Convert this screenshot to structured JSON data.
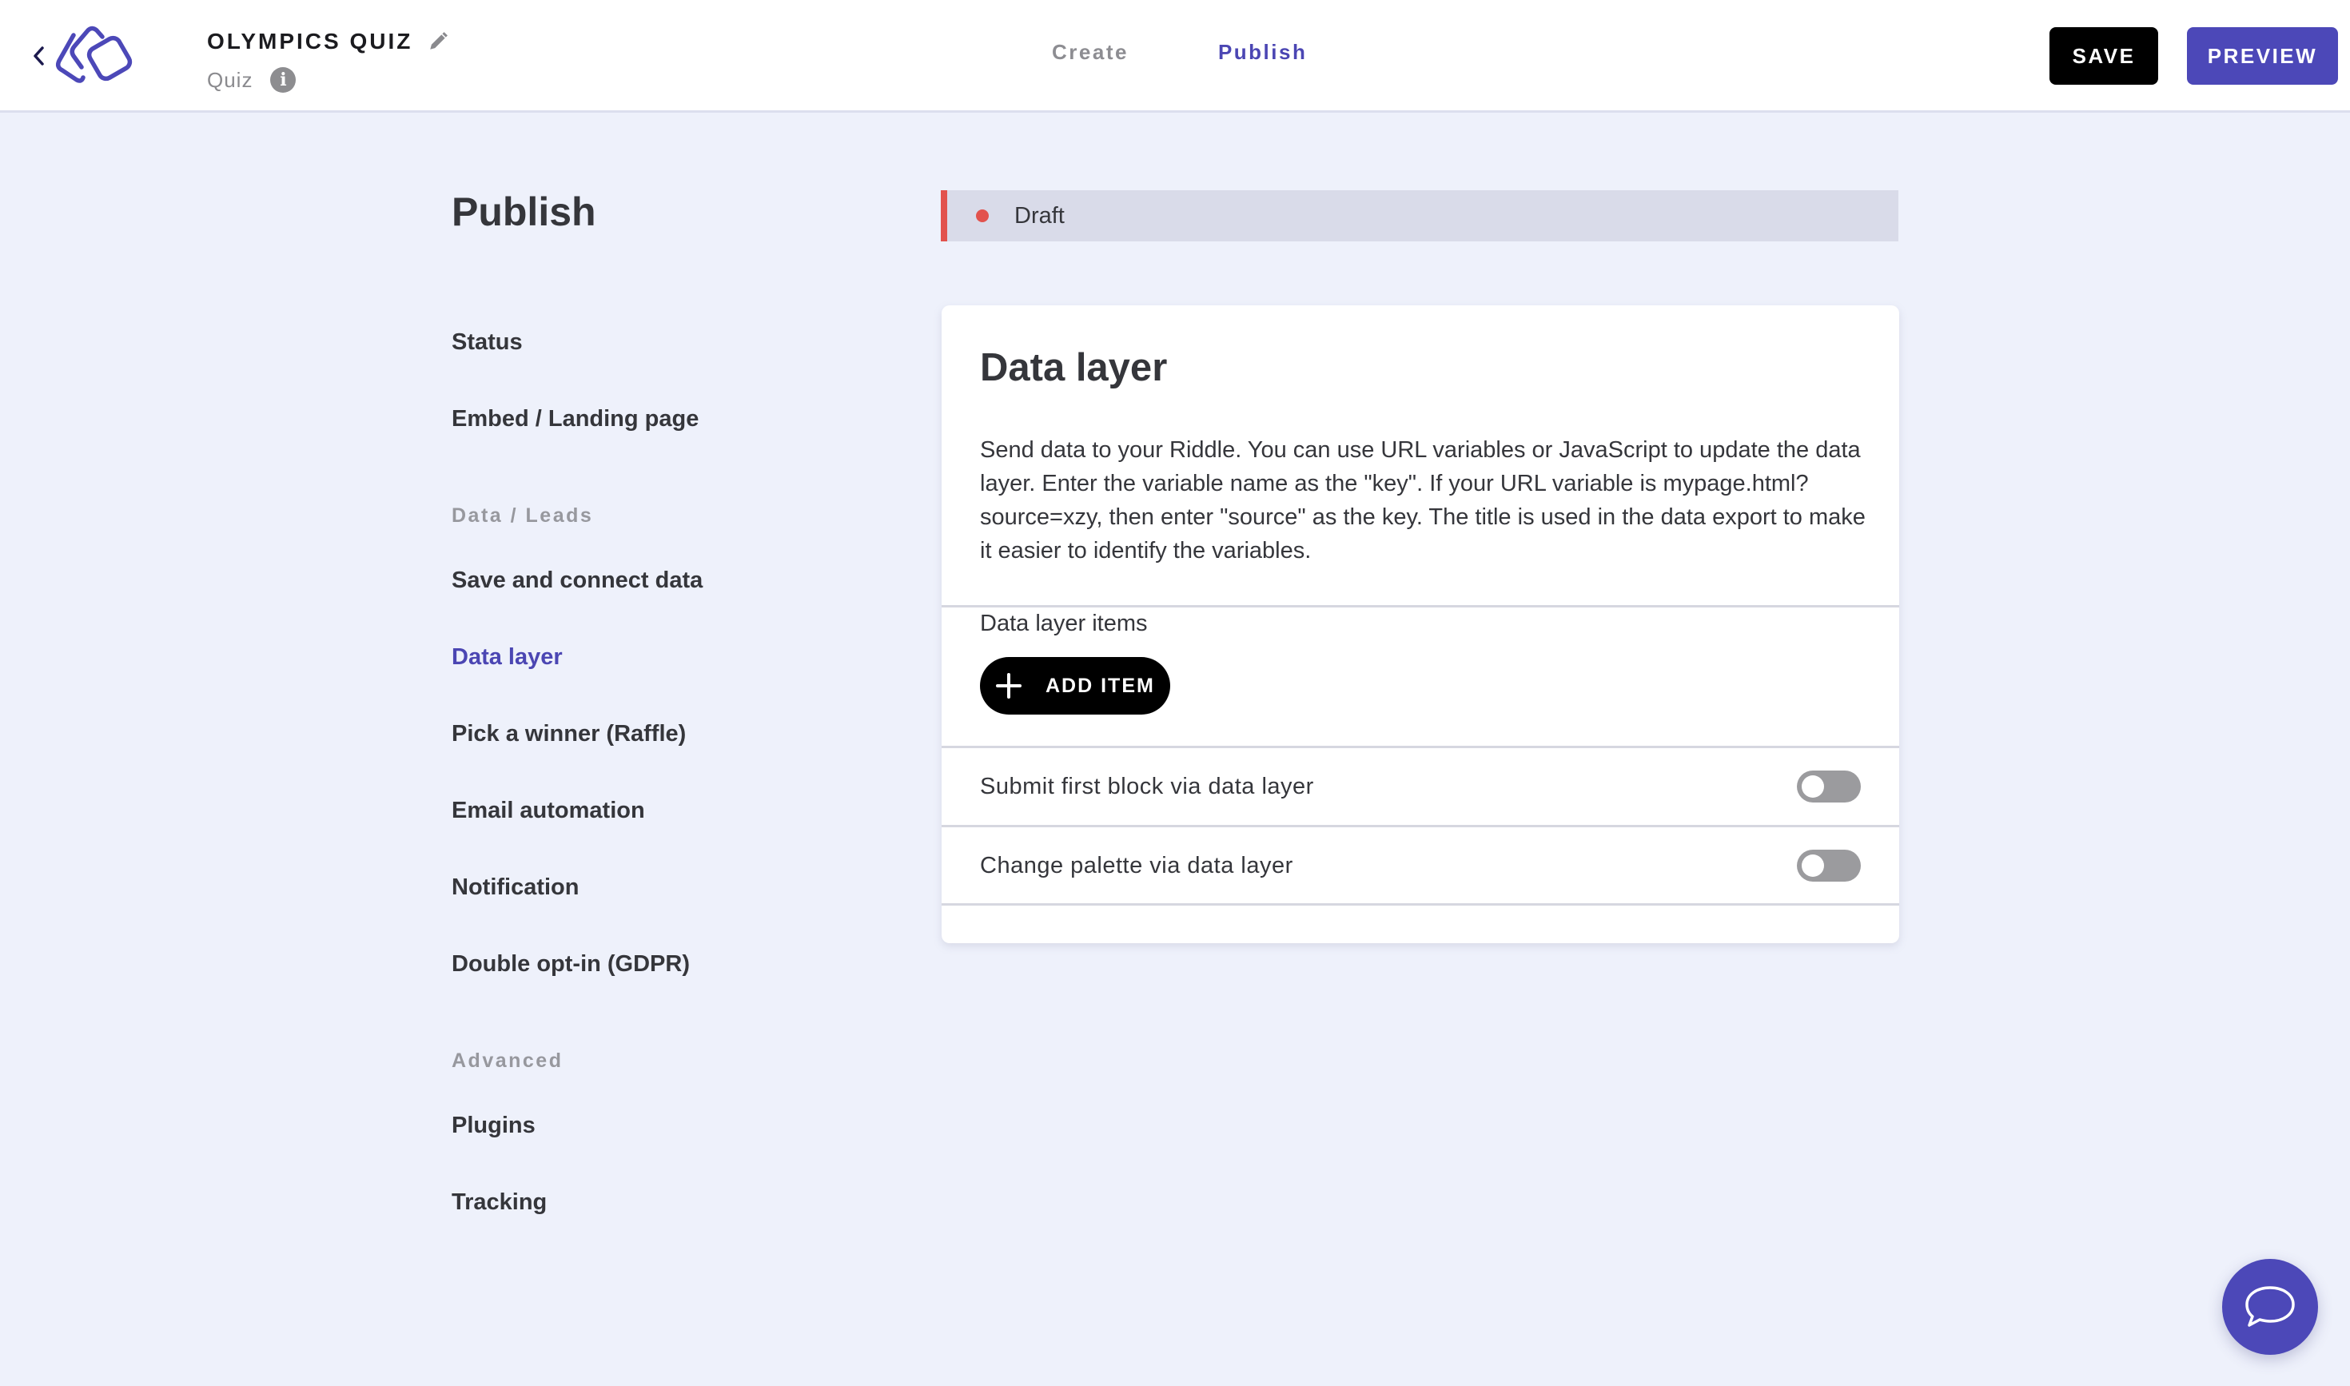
{
  "header": {
    "quiz_title": "OLYMPICS QUIZ",
    "quiz_type": "Quiz",
    "tabs": [
      {
        "label": "Create",
        "active": false
      },
      {
        "label": "Publish",
        "active": true
      }
    ],
    "save_label": "SAVE",
    "preview_label": "PREVIEW",
    "icons": {
      "back": "chevron-left-icon",
      "logo": "riddle-logo",
      "edit": "pencil-icon",
      "info": "info-icon"
    }
  },
  "sidebar": {
    "title": "Publish",
    "items_top": [
      {
        "label": "Status"
      },
      {
        "label": "Embed / Landing page"
      }
    ],
    "section_data": "Data / Leads",
    "items_data": [
      {
        "label": "Save and connect data",
        "active": false
      },
      {
        "label": "Data layer",
        "active": true
      },
      {
        "label": "Pick a winner (Raffle)",
        "active": false
      },
      {
        "label": "Email automation",
        "active": false
      },
      {
        "label": "Notification",
        "active": false
      },
      {
        "label": "Double opt-in (GDPR)",
        "active": false
      }
    ],
    "section_advanced": "Advanced",
    "items_advanced": [
      {
        "label": "Plugins"
      },
      {
        "label": "Tracking"
      }
    ]
  },
  "status": {
    "label": "Draft",
    "color": "#e2524d"
  },
  "card": {
    "title": "Data layer",
    "description": "Send data to your Riddle. You can use URL variables or JavaScript to update the data layer. Enter the variable name as the \"key\". If your URL variable is mypage.html?source=xzy, then enter \"source\" as the key. The title is used in the data export to make it easier to identify the variables.",
    "items_label": "Data layer items",
    "add_item_label": "ADD ITEM",
    "toggles": [
      {
        "label": "Submit first block via data layer",
        "on": false
      },
      {
        "label": "Change palette via data layer",
        "on": false
      }
    ]
  },
  "colors": {
    "accent": "#4c48b8",
    "background": "#eef1fb",
    "draft": "#e2524d"
  },
  "chat": {
    "icon": "chat-bubble-icon"
  }
}
